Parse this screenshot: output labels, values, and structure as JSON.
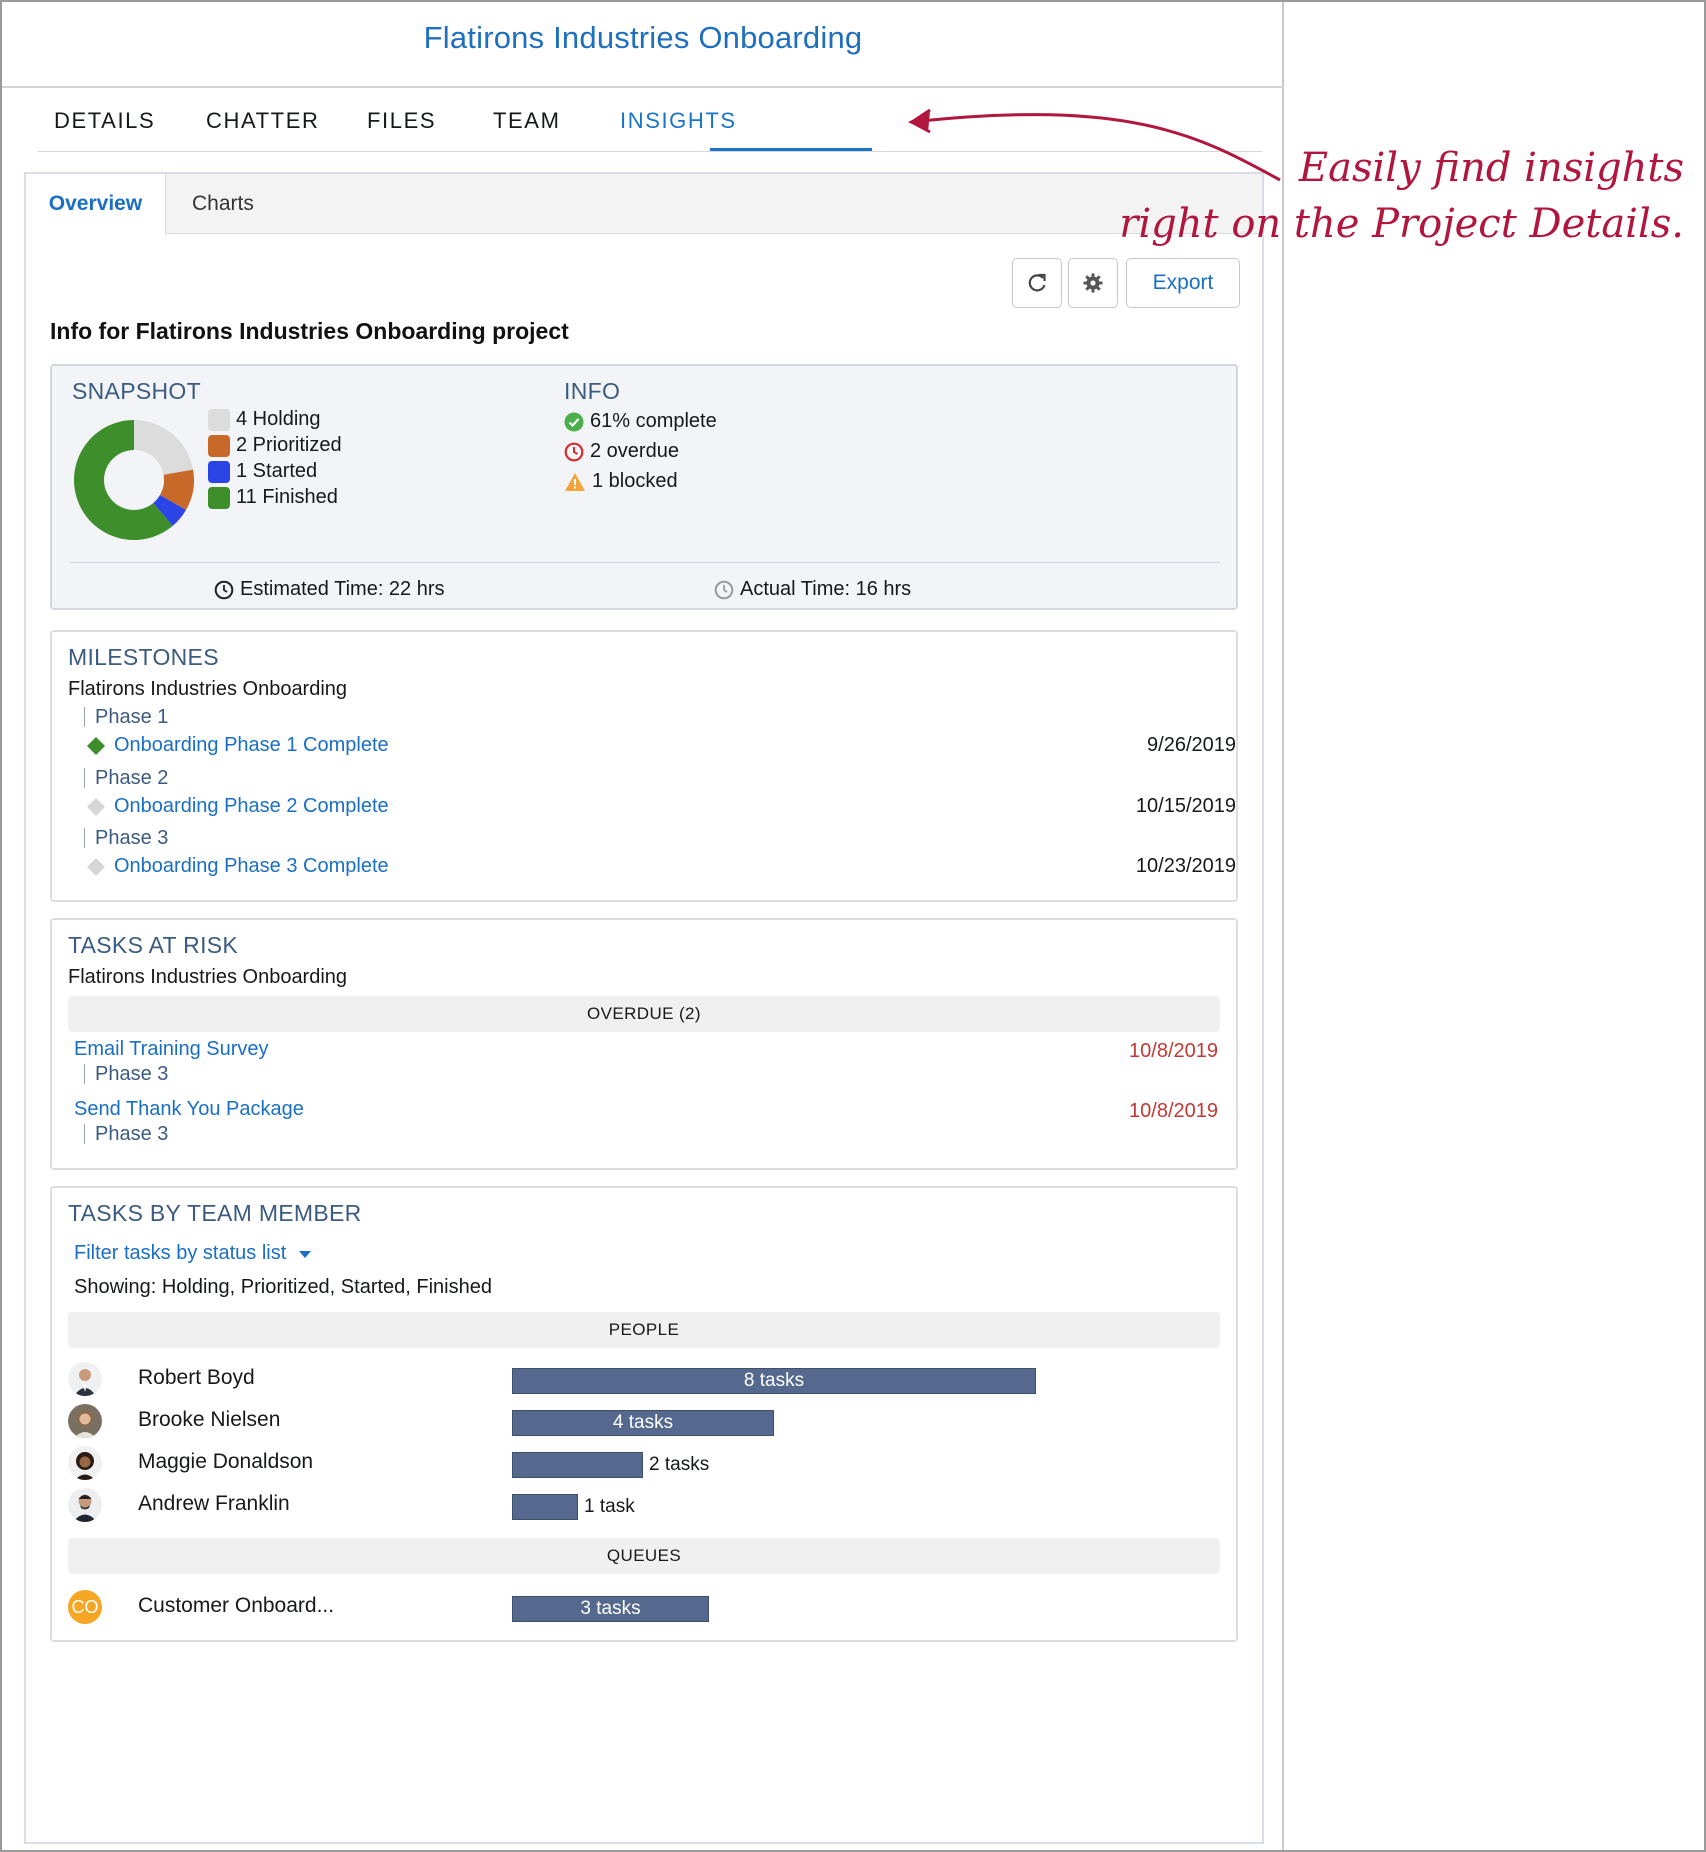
{
  "header": {
    "title": "Flatirons Industries Onboarding"
  },
  "tabs": [
    {
      "label": "DETAILS"
    },
    {
      "label": "CHATTER"
    },
    {
      "label": "FILES"
    },
    {
      "label": "TEAM"
    },
    {
      "label": "INSIGHTS",
      "active": true
    }
  ],
  "subtabs": {
    "overview": "Overview",
    "charts": "Charts"
  },
  "toolbar": {
    "refresh_icon": "refresh-icon",
    "settings_icon": "gear-icon",
    "export_label": "Export"
  },
  "info_heading": "Info for Flatirons Industries Onboarding project",
  "snapshot": {
    "title": "SNAPSHOT",
    "legend": [
      {
        "label": "4 Holding",
        "color": "#dcdcdc",
        "value": 4
      },
      {
        "label": "2 Prioritized",
        "color": "#c8692a",
        "value": 2
      },
      {
        "label": "1 Started",
        "color": "#2b44e6",
        "value": 1
      },
      {
        "label": "11 Finished",
        "color": "#3e8e2b",
        "value": 11
      }
    ],
    "estimated_time": "Estimated Time: 22 hrs",
    "actual_time": "Actual Time: 16 hrs"
  },
  "info": {
    "title": "INFO",
    "complete": "61% complete",
    "overdue": "2 overdue",
    "blocked": "1 blocked",
    "colors": {
      "complete": "#4bb04b",
      "overdue": "#d62b2b",
      "blocked": "#f4a43a"
    }
  },
  "milestones": {
    "title": "MILESTONES",
    "project": "Flatirons Industries Onboarding",
    "items": [
      {
        "phase": "Phase 1",
        "milestone": "Onboarding Phase 1 Complete",
        "date": "9/26/2019",
        "done": true
      },
      {
        "phase": "Phase 2",
        "milestone": "Onboarding Phase 2 Complete",
        "date": "10/15/2019",
        "done": false
      },
      {
        "phase": "Phase 3",
        "milestone": "Onboarding Phase 3 Complete",
        "date": "10/23/2019",
        "done": false
      }
    ]
  },
  "tasks_at_risk": {
    "title": "TASKS AT RISK",
    "project": "Flatirons Industries Onboarding",
    "group_label": "OVERDUE (2)",
    "items": [
      {
        "task": "Email Training Survey",
        "phase": "Phase 3",
        "date": "10/8/2019"
      },
      {
        "task": "Send Thank You Package",
        "phase": "Phase 3",
        "date": "10/8/2019"
      }
    ]
  },
  "team": {
    "title": "TASKS BY TEAM MEMBER",
    "filter_label": "Filter tasks by status list",
    "showing": "Showing: Holding, Prioritized, Started, Finished",
    "people_label": "PEOPLE",
    "people": [
      {
        "name": "Robert Boyd",
        "count": 8,
        "count_label": "8 tasks"
      },
      {
        "name": "Brooke Nielsen",
        "count": 4,
        "count_label": "4 tasks"
      },
      {
        "name": "Maggie Donaldson",
        "count": 2,
        "count_label": "2 tasks"
      },
      {
        "name": "Andrew Franklin",
        "count": 1,
        "count_label": "1 task"
      }
    ],
    "queues_label": "QUEUES",
    "queues": [
      {
        "name": "Customer Onboard...",
        "initials": "CO",
        "count": 3,
        "count_label": "3 tasks"
      }
    ]
  },
  "annotation": {
    "line1": "Easily find insights",
    "line2": "right on the Project Details."
  }
}
